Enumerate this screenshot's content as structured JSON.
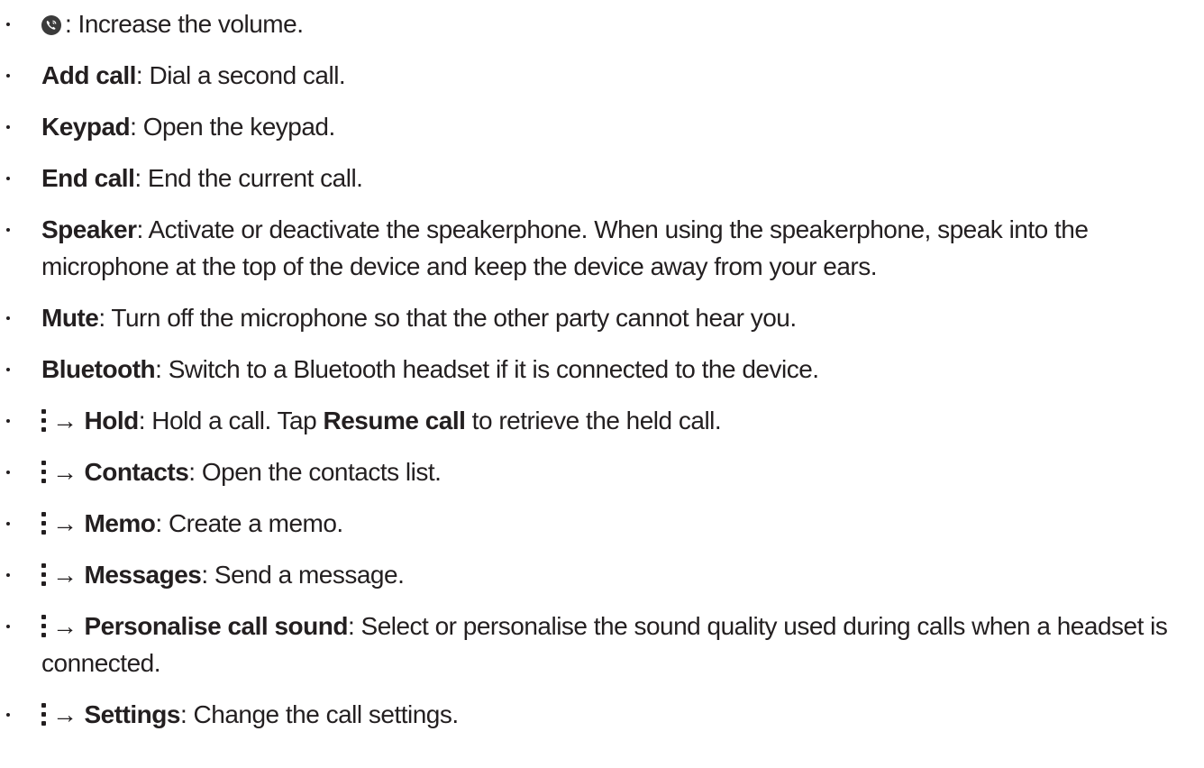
{
  "items": [
    {
      "icon": "volume-up-icon",
      "text": ": Increase the volume."
    },
    {
      "label": "Add call",
      "text": ": Dial a second call."
    },
    {
      "label": "Keypad",
      "text": ": Open the keypad."
    },
    {
      "label": "End call",
      "text": ": End the current call."
    },
    {
      "label": "Speaker",
      "text": ": Activate or deactivate the speakerphone. When using the speakerphone, speak into the microphone at the top of the device and keep the device away from your ears."
    },
    {
      "label": "Mute",
      "text": ": Turn off the microphone so that the other party cannot hear you."
    },
    {
      "label": "Bluetooth",
      "text": ": Switch to a Bluetooth headset if it is connected to the device."
    },
    {
      "icon": "more-options-icon",
      "arrow": "→",
      "label": "Hold",
      "text": ": Hold a call. Tap ",
      "label2": "Resume call",
      "text2": " to retrieve the held call."
    },
    {
      "icon": "more-options-icon",
      "arrow": "→",
      "label": "Contacts",
      "text": ": Open the contacts list."
    },
    {
      "icon": "more-options-icon",
      "arrow": "→",
      "label": "Memo",
      "text": ": Create a memo."
    },
    {
      "icon": "more-options-icon",
      "arrow": "→",
      "label": "Messages",
      "text": ": Send a message."
    },
    {
      "icon": "more-options-icon",
      "arrow": "→",
      "label": "Personalise call sound",
      "text": ": Select or personalise the sound quality used during calls when a headset is connected."
    },
    {
      "icon": "more-options-icon",
      "arrow": "→",
      "label": "Settings",
      "text": ": Change the call settings."
    }
  ]
}
